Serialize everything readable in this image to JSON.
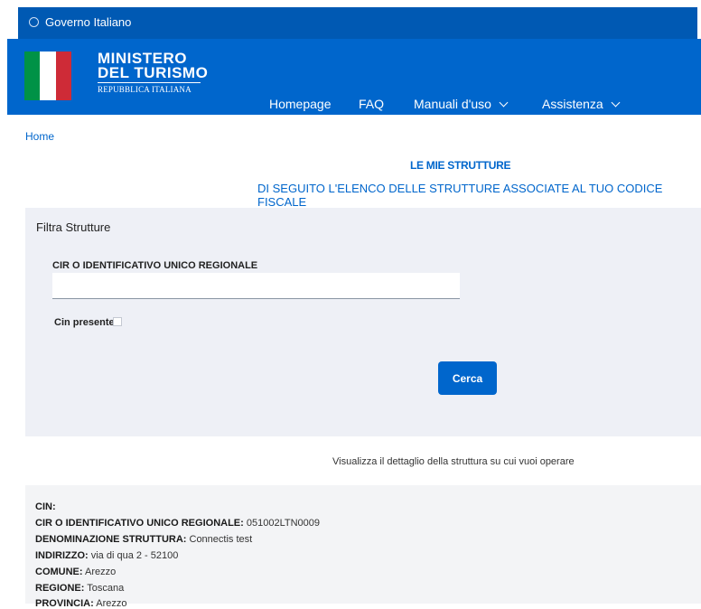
{
  "topbar": {
    "label": "Governo Italiano",
    "icon": "globe-icon"
  },
  "header": {
    "logo_line1": "MINISTERO",
    "logo_line2": "DEL TURISMO",
    "logo_line3": "REPUBBLICA ITALIANA",
    "flag_colors": [
      "#009246",
      "#ffffff",
      "#ce2b37"
    ],
    "nav": [
      {
        "label": "Homepage",
        "has_dropdown": false
      },
      {
        "label": "FAQ",
        "has_dropdown": false
      },
      {
        "label": "Manuali d'uso",
        "has_dropdown": true
      },
      {
        "label": "Assistenza",
        "has_dropdown": true
      }
    ]
  },
  "breadcrumb": {
    "home": "Home"
  },
  "page": {
    "title": "LE MIE STRUTTURE",
    "subtitle": "DI SEGUITO L'ELENCO DELLE STRUTTURE ASSOCIATE AL TUO CODICE FISCALE"
  },
  "filter": {
    "title": "Filtra Strutture",
    "cir_label": "CIR O IDENTIFICATIVO UNICO REGIONALE",
    "cir_value": "",
    "cin_label": "Cin presente",
    "cin_checked": false,
    "search_button": "Cerca"
  },
  "helper_text": "Visualizza il dettaglio della struttura su cui vuoi operare",
  "detail": {
    "rows": [
      {
        "label": "CIN:",
        "value": ""
      },
      {
        "label": "CIR O IDENTIFICATIVO UNICO REGIONALE:",
        "value": "051002LTN0009"
      },
      {
        "label": "DENOMINAZIONE STRUTTURA:",
        "value": "Connectis test"
      },
      {
        "label": "INDIRIZZO:",
        "value": "via di qua 2 - 52100"
      },
      {
        "label": "COMUNE:",
        "value": "Arezzo"
      },
      {
        "label": "REGIONE:",
        "value": "Toscana"
      },
      {
        "label": "PROVINCIA:",
        "value": "Arezzo"
      }
    ]
  },
  "colors": {
    "primary": "#0066cc",
    "topbar": "#0059b3",
    "filter_bg": "#eef0f6",
    "detail_bg": "#f3f4f6"
  }
}
